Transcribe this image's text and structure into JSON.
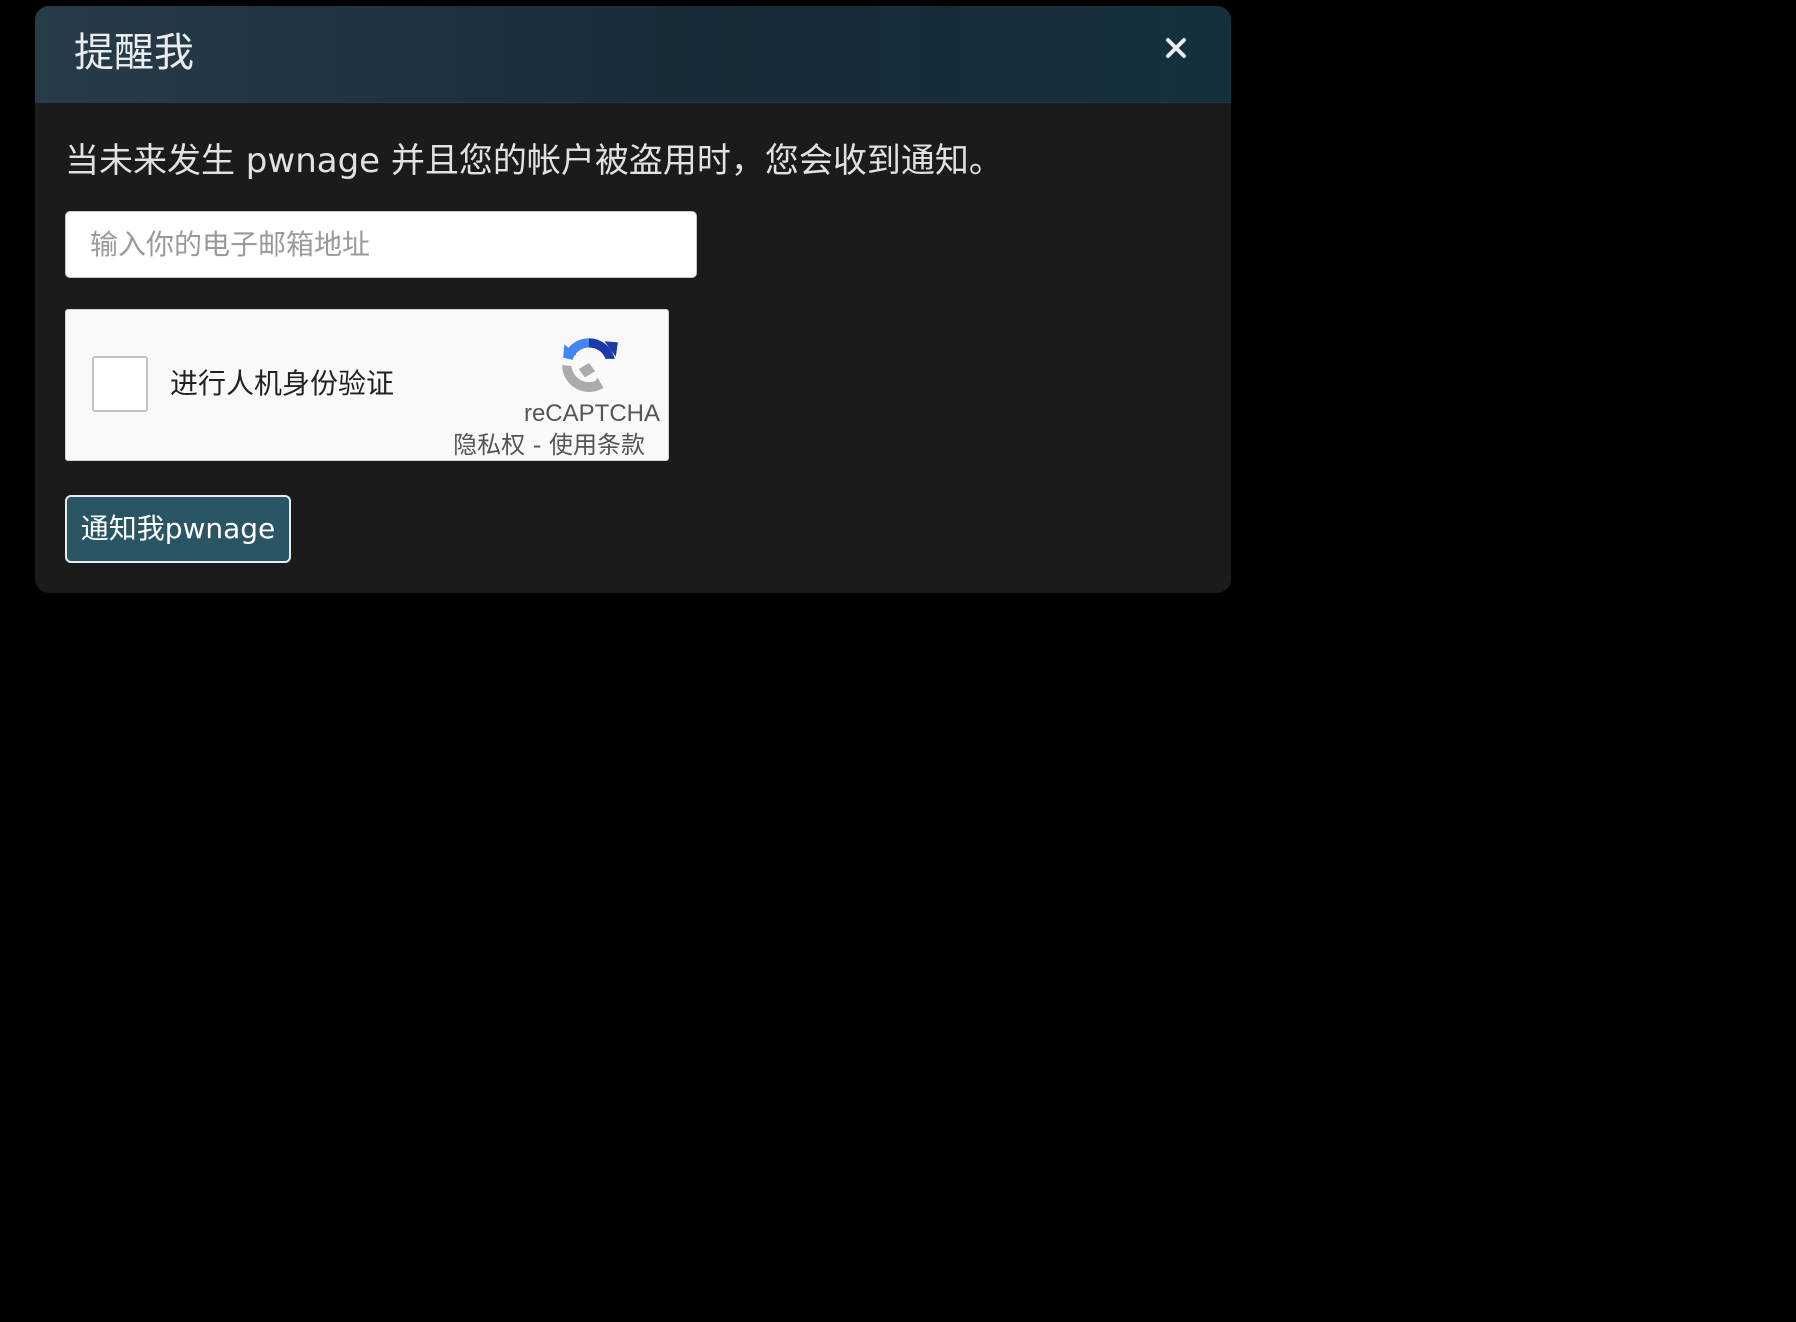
{
  "modal": {
    "title": "提醒我",
    "close_icon": "close-icon",
    "description": "当未来发生 pwnage 并且您的帐户被盗用时，您会收到通知。",
    "email_placeholder": "输入你的电子邮箱地址",
    "email_value": "",
    "submit_label": "通知我pwnage"
  },
  "recaptcha": {
    "label": "进行人机身份验证",
    "brand": "reCAPTCHA",
    "privacy": "隐私权",
    "separator": " - ",
    "terms": "使用条款",
    "logo_icon": "recaptcha-logo-icon",
    "checked": false
  },
  "colors": {
    "background": "#000000",
    "modal_body": "#1b1b1b",
    "modal_header": "#1c2f3b",
    "button": "#2a5565"
  }
}
